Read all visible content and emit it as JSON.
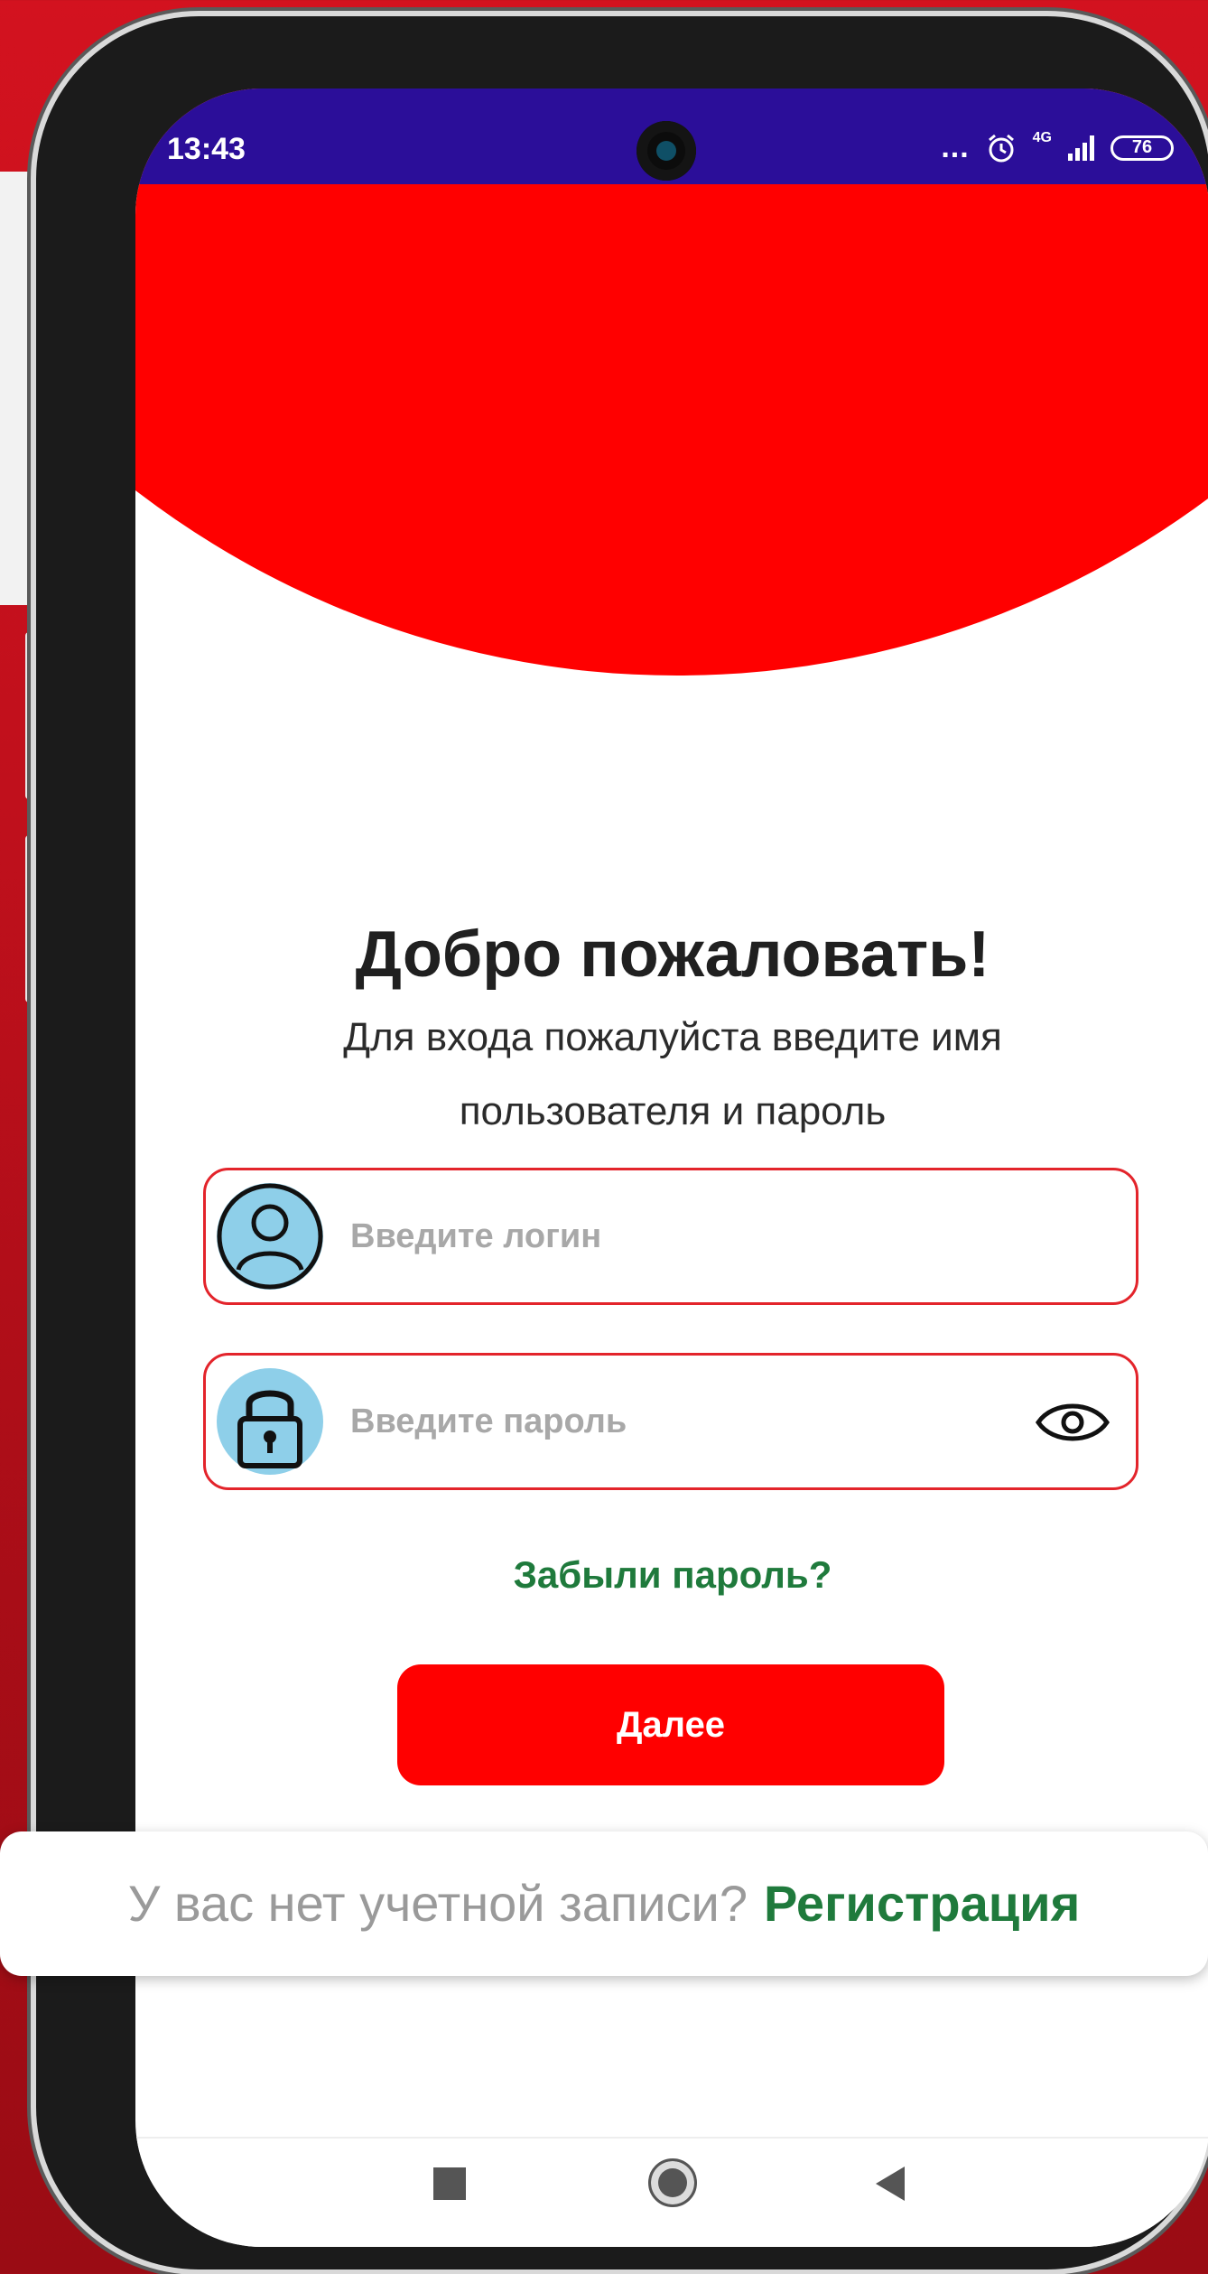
{
  "status_bar": {
    "time": "13:43",
    "more": "...",
    "network": "4G",
    "battery": "76"
  },
  "login": {
    "title": "Добро пожаловать!",
    "subtitle": "Для входа пожалуйста введите имя пользователя и пароль",
    "login_placeholder": "Введите логин",
    "password_placeholder": "Введите пароль",
    "forgot_password": "Забыли пароль?",
    "next_button": "Далее"
  },
  "signup": {
    "question": "У вас нет учетной записи?",
    "link": "Регистрация"
  },
  "colors": {
    "accent_red": "#ff0000",
    "link_green": "#1f7a3c",
    "status_bar": "#2b0e99"
  }
}
